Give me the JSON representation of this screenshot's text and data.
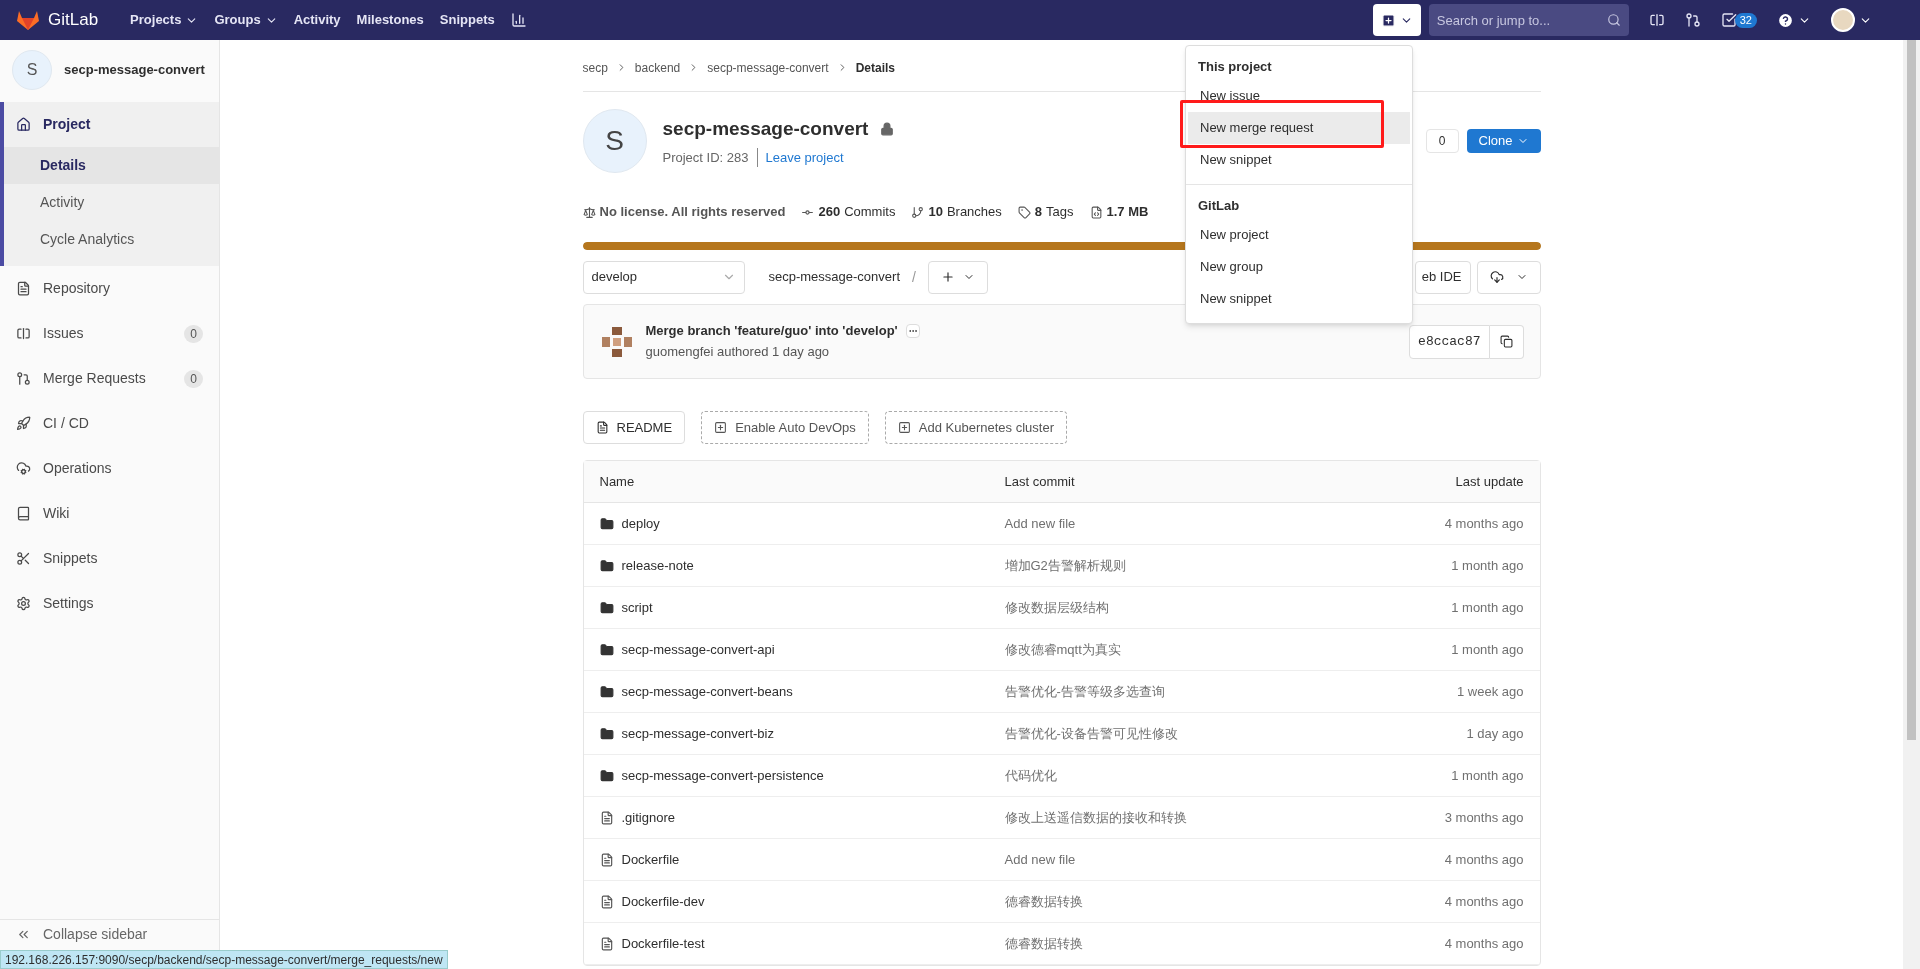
{
  "navbar": {
    "brand": "GitLab",
    "items": [
      {
        "label": "Projects",
        "dropdown": true
      },
      {
        "label": "Groups",
        "dropdown": true
      },
      {
        "label": "Activity",
        "dropdown": false
      },
      {
        "label": "Milestones",
        "dropdown": false
      },
      {
        "label": "Snippets",
        "dropdown": false
      }
    ],
    "search": {
      "placeholder": "Search or jump to..."
    },
    "todo_count": "32"
  },
  "sidebar": {
    "project_letter": "S",
    "project_name": "secp-message-convert",
    "items": [
      {
        "label": "Project",
        "expanded": true,
        "children": [
          {
            "label": "Details",
            "selected": true
          },
          {
            "label": "Activity",
            "selected": false
          },
          {
            "label": "Cycle Analytics",
            "selected": false
          }
        ]
      },
      {
        "label": "Repository",
        "expanded": false
      },
      {
        "label": "Issues",
        "expanded": false,
        "count": "0"
      },
      {
        "label": "Merge Requests",
        "expanded": false,
        "count": "0"
      },
      {
        "label": "CI / CD",
        "expanded": false
      },
      {
        "label": "Operations",
        "expanded": false
      },
      {
        "label": "Wiki",
        "expanded": false
      },
      {
        "label": "Snippets",
        "expanded": false
      },
      {
        "label": "Settings",
        "expanded": false
      }
    ],
    "collapse": "Collapse sidebar"
  },
  "breadcrumbs": [
    "secp",
    "backend",
    "secp-message-convert",
    "Details"
  ],
  "project": {
    "letter": "S",
    "name": "secp-message-convert",
    "id": "Project ID: 283",
    "leave": "Leave project",
    "star_count": "0",
    "clone": "Clone"
  },
  "stats": [
    {
      "kind": "license",
      "bold": "No license. All rights reserved"
    },
    {
      "kind": "commits",
      "bold": "260",
      "label": "Commits"
    },
    {
      "kind": "branches",
      "bold": "10",
      "label": "Branches"
    },
    {
      "kind": "tags",
      "bold": "8",
      "label": "Tags"
    },
    {
      "kind": "size",
      "bold": "1.7 MB"
    }
  ],
  "storage_bar": {
    "level": 1
  },
  "toolbar": {
    "branch": "develop",
    "path": "secp-message-convert",
    "path_sep": "/",
    "web_ide": "eb IDE"
  },
  "commit": {
    "title": "Merge branch 'feature/guo' into 'develop'",
    "author": "guomengfei authored 1 day ago",
    "sha": "e8ccac87"
  },
  "actions": [
    {
      "label": "README",
      "kind": "solid"
    },
    {
      "label": "Enable Auto DevOps",
      "kind": "dashed"
    },
    {
      "label": "Add Kubernetes cluster",
      "kind": "dashed"
    }
  ],
  "table": {
    "columns": [
      "Name",
      "Last commit",
      "Last update"
    ],
    "rows": [
      {
        "kind": "folder",
        "name": "deploy",
        "commit": "Add new file",
        "updated": "4 months ago"
      },
      {
        "kind": "folder",
        "name": "release-note",
        "commit": "增加G2告警解析规则",
        "updated": "1 month ago"
      },
      {
        "kind": "folder",
        "name": "script",
        "commit": "修改数据层级结构",
        "updated": "1 month ago"
      },
      {
        "kind": "folder",
        "name": "secp-message-convert-api",
        "commit": "修改德睿mqtt为真实",
        "updated": "1 month ago"
      },
      {
        "kind": "folder",
        "name": "secp-message-convert-beans",
        "commit": "告警优化-告警等级多选查询",
        "updated": "1 week ago"
      },
      {
        "kind": "folder",
        "name": "secp-message-convert-biz",
        "commit": "告警优化-设备告警可见性修改",
        "updated": "1 day ago"
      },
      {
        "kind": "folder",
        "name": "secp-message-convert-persistence",
        "commit": "代码优化",
        "updated": "1 month ago"
      },
      {
        "kind": "file",
        "name": ".gitignore",
        "commit": "修改上送遥信数据的接收和转换",
        "updated": "3 months ago"
      },
      {
        "kind": "file",
        "name": "Dockerfile",
        "commit": "Add new file",
        "updated": "4 months ago"
      },
      {
        "kind": "file",
        "name": "Dockerfile-dev",
        "commit": "德睿数据转换",
        "updated": "4 months ago"
      },
      {
        "kind": "file",
        "name": "Dockerfile-test",
        "commit": "德睿数据转换",
        "updated": "4 months ago"
      }
    ]
  },
  "dropdown": {
    "sections": [
      {
        "header": "This project",
        "items": [
          {
            "label": "New issue",
            "selected": false
          },
          {
            "label": "New merge request",
            "selected": true
          },
          {
            "label": "New snippet",
            "selected": false
          }
        ]
      },
      {
        "header": "GitLab",
        "items": [
          {
            "label": "New project",
            "selected": false
          },
          {
            "label": "New group",
            "selected": false
          },
          {
            "label": "New snippet",
            "selected": false
          }
        ]
      }
    ]
  },
  "status_url": "192.168.226.157:9090/secp/backend/secp-message-convert/merge_requests/new"
}
